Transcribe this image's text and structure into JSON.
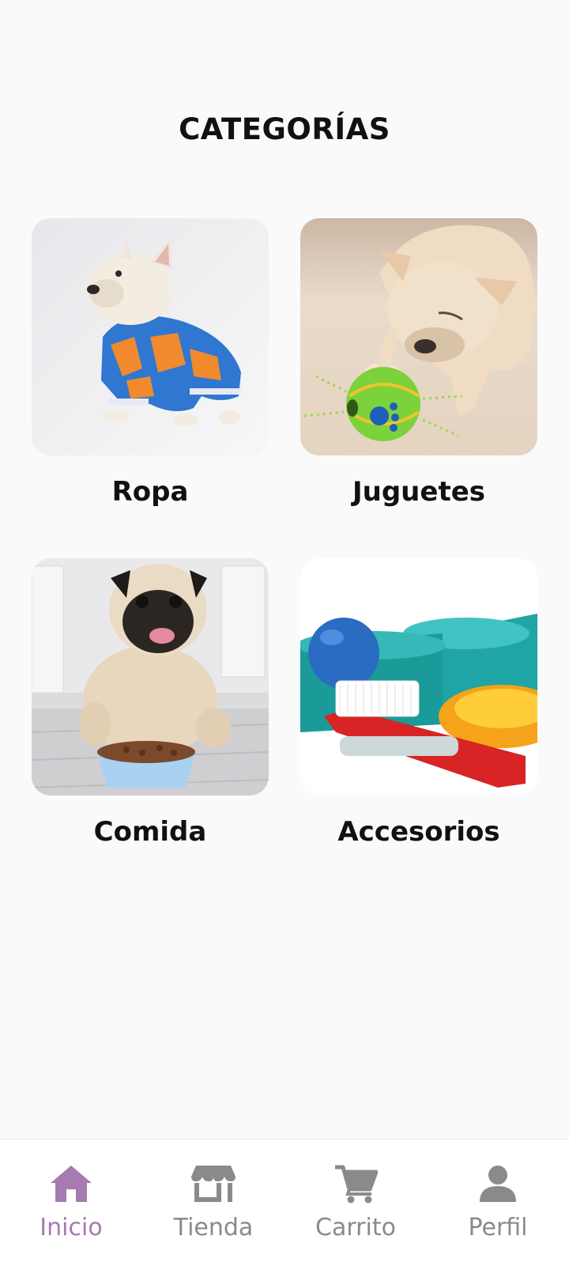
{
  "page": {
    "title": "CATEGORÍAS"
  },
  "categories": [
    {
      "label": "Ropa",
      "image": "french-bulldog-in-hoodie"
    },
    {
      "label": "Juguetes",
      "image": "bulldog-with-toy-ball"
    },
    {
      "label": "Comida",
      "image": "pug-with-food-bowl"
    },
    {
      "label": "Accesorios",
      "image": "pet-bowls-and-brush"
    }
  ],
  "nav": {
    "items": [
      {
        "label": "Inicio",
        "icon": "home-icon",
        "active": true
      },
      {
        "label": "Tienda",
        "icon": "store-icon",
        "active": false
      },
      {
        "label": "Carrito",
        "icon": "cart-icon",
        "active": false
      },
      {
        "label": "Perfil",
        "icon": "user-icon",
        "active": false
      }
    ]
  },
  "colors": {
    "background": "#fafafa",
    "accent": "#a57bb0",
    "inactive": "#8a8a8a",
    "text": "#111111"
  }
}
